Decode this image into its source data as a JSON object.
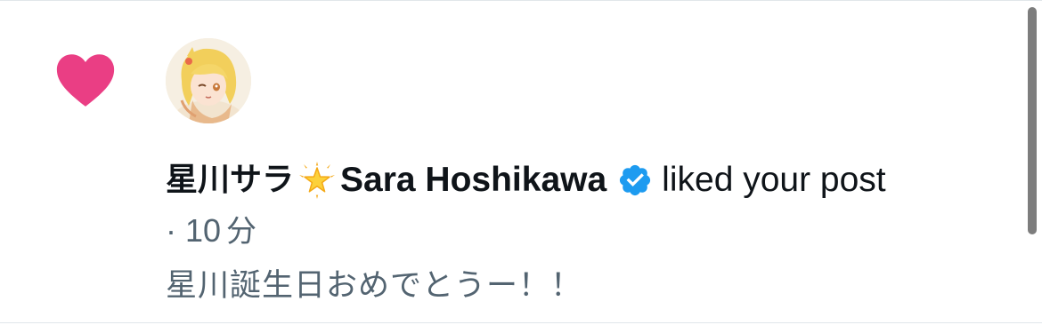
{
  "notification": {
    "type_icon": "heart-icon",
    "type_color": "#f91880",
    "avatar_icon": "avatar",
    "user": {
      "name_jp": "星川サラ",
      "name_emoji": "star-icon",
      "name_en": "Sara Hoshikawa",
      "verified": true,
      "verified_color": "#1d9bf0"
    },
    "action": "liked your post",
    "time": {
      "separator": "·",
      "value": "10",
      "unit": "分"
    },
    "post_excerpt": "星川誕生日おめでとうー！！"
  }
}
